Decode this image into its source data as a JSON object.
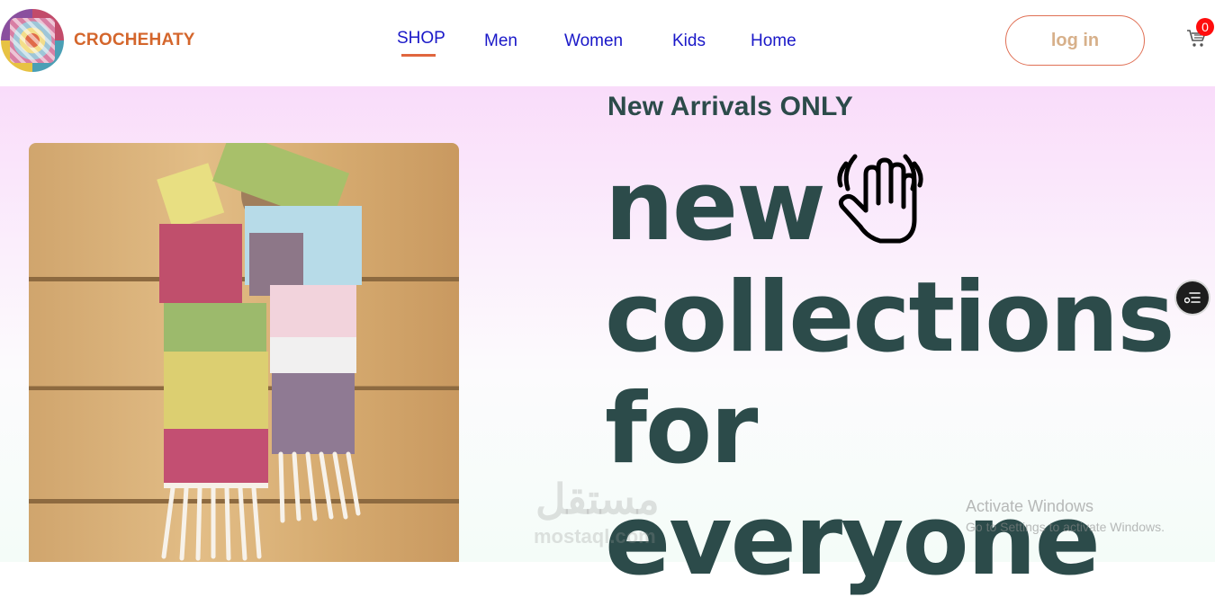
{
  "header": {
    "brand": "CROCHEHATY",
    "nav": [
      {
        "label": "SHOP",
        "active": true
      },
      {
        "label": "Men"
      },
      {
        "label": "Women"
      },
      {
        "label": "Kids"
      },
      {
        "label": "Home"
      }
    ],
    "login_label": "log in",
    "cart_count": "0",
    "icons": {
      "logo": "crochet-granny-square-avatar",
      "cart": "cart-icon"
    }
  },
  "hero": {
    "subtitle": "New Arrivals ONLY",
    "title_lines": [
      "new",
      "collections",
      "for",
      "everyone"
    ],
    "title_icon": "waving-hand-icon",
    "image": "crochet-scarf-photo",
    "side_widget_icon": "menu-list-icon"
  },
  "overlays": {
    "watermark_arabic": "مستقل",
    "watermark_latin": "mostaql.com",
    "activation_title": "Activate Windows",
    "activation_sub": "Go to Settings to activate Windows."
  },
  "colors": {
    "brand": "#d4662c",
    "nav": "#1a18c8",
    "accent": "#e0663e",
    "hero_text": "#2c4b4a",
    "badge": "#ff0d0d"
  }
}
